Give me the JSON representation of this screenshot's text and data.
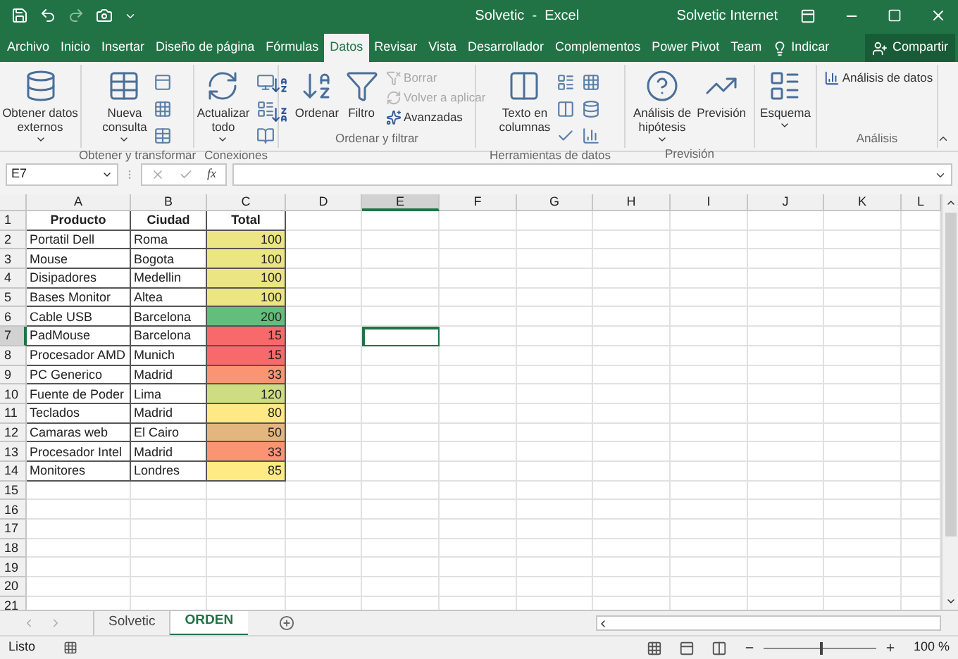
{
  "title_bar": {
    "title": "Solvetic  -  Excel",
    "user": "Solvetic Internet"
  },
  "menu_tabs": [
    {
      "label": "Archivo",
      "selected": false
    },
    {
      "label": "Inicio",
      "selected": false
    },
    {
      "label": "Insertar",
      "selected": false
    },
    {
      "label": "Diseño de página",
      "selected": false
    },
    {
      "label": "Fórmulas",
      "selected": false
    },
    {
      "label": "Datos",
      "selected": true
    },
    {
      "label": "Revisar",
      "selected": false
    },
    {
      "label": "Vista",
      "selected": false
    },
    {
      "label": "Desarrollador",
      "selected": false
    },
    {
      "label": "Complementos",
      "selected": false
    },
    {
      "label": "Power Pivot",
      "selected": false
    },
    {
      "label": "Team",
      "selected": false
    }
  ],
  "tell_me": "Indicar",
  "share": "Compartir",
  "ribbon_groups": [
    {
      "buttons": [
        {
          "kind": "large",
          "lines": [
            "Obtener datos",
            "externos"
          ],
          "dropdown": true
        }
      ]
    },
    {
      "label": "Obtener y transformar",
      "buttons": [
        {
          "kind": "large",
          "lines": [
            "Nueva",
            "consulta"
          ],
          "dropdown": true
        }
      ]
    },
    {
      "label": "Conexiones",
      "buttons": [
        {
          "kind": "large",
          "lines": [
            "Actualizar",
            "todo"
          ],
          "dropdown": true
        }
      ]
    },
    {
      "label": "Ordenar y filtrar",
      "buttons": [
        {
          "kind": "large",
          "lines": [
            "Ordenar"
          ],
          "dropdown": false
        },
        {
          "kind": "large",
          "lines": [
            "Filtro"
          ],
          "dropdown": false
        },
        {
          "kind": "small",
          "lines": [
            "Borrar"
          ],
          "disabled": true
        },
        {
          "kind": "small",
          "lines": [
            "Volver a aplicar"
          ],
          "disabled": true
        },
        {
          "kind": "small",
          "lines": [
            "Avanzadas"
          ],
          "disabled": false
        }
      ]
    },
    {
      "label": "Herramientas de datos",
      "buttons": [
        {
          "kind": "large",
          "lines": [
            "Texto en",
            "columnas"
          ],
          "dropdown": false
        }
      ]
    },
    {
      "label": "Previsión",
      "buttons": [
        {
          "kind": "large",
          "lines": [
            "Análisis de",
            "hipótesis"
          ],
          "dropdown": true
        },
        {
          "kind": "large",
          "lines": [
            "Previsión"
          ],
          "dropdown": false
        }
      ]
    },
    {
      "buttons": [
        {
          "kind": "large",
          "lines": [
            "Esquema"
          ],
          "dropdown": true
        }
      ]
    },
    {
      "label": "Análisis",
      "buttons": [
        {
          "kind": "small",
          "lines": [
            "Análisis de datos"
          ],
          "disabled": false
        }
      ]
    }
  ],
  "formula_bar": {
    "name_box": "E7",
    "function_label": "fx"
  },
  "sheet": {
    "columns": [
      {
        "label": "A",
        "selected": false
      },
      {
        "label": "B",
        "selected": false
      },
      {
        "label": "C",
        "selected": false
      },
      {
        "label": "D",
        "selected": false
      },
      {
        "label": "E",
        "selected": true
      },
      {
        "label": "F",
        "selected": false
      },
      {
        "label": "G",
        "selected": false
      },
      {
        "label": "H",
        "selected": false
      },
      {
        "label": "I",
        "selected": false
      },
      {
        "label": "J",
        "selected": false
      },
      {
        "label": "K",
        "selected": false
      },
      {
        "label": "L",
        "selected": false
      }
    ],
    "rows": [
      {
        "number": "1",
        "selected": false,
        "cells": [
          {
            "text": "Producto",
            "kind": "header"
          },
          {
            "text": "Ciudad",
            "kind": "header"
          },
          {
            "text": "Total",
            "kind": "header"
          }
        ]
      },
      {
        "number": "2",
        "selected": false,
        "cells": [
          {
            "text": "Portatil Dell",
            "kind": "text"
          },
          {
            "text": "Roma",
            "kind": "text"
          },
          {
            "text": "100",
            "kind": "number",
            "color": "#ece583"
          }
        ]
      },
      {
        "number": "3",
        "selected": false,
        "cells": [
          {
            "text": "Mouse",
            "kind": "text"
          },
          {
            "text": "Bogota",
            "kind": "text"
          },
          {
            "text": "100",
            "kind": "number",
            "color": "#ece583"
          }
        ]
      },
      {
        "number": "4",
        "selected": false,
        "cells": [
          {
            "text": "Disipadores",
            "kind": "text"
          },
          {
            "text": "Medellin",
            "kind": "text"
          },
          {
            "text": "100",
            "kind": "number",
            "color": "#ece583"
          }
        ]
      },
      {
        "number": "5",
        "selected": false,
        "cells": [
          {
            "text": "Bases Monitor",
            "kind": "text"
          },
          {
            "text": "Altea",
            "kind": "text"
          },
          {
            "text": "100",
            "kind": "number",
            "color": "#ece583"
          }
        ]
      },
      {
        "number": "6",
        "selected": false,
        "cells": [
          {
            "text": "Cable USB",
            "kind": "text"
          },
          {
            "text": "Barcelona",
            "kind": "text"
          },
          {
            "text": "200",
            "kind": "number",
            "color": "#63be7b"
          }
        ]
      },
      {
        "number": "7",
        "selected": true,
        "cells": [
          {
            "text": "PadMouse",
            "kind": "text"
          },
          {
            "text": "Barcelona",
            "kind": "text"
          },
          {
            "text": "15",
            "kind": "number",
            "color": "#f8696b"
          }
        ]
      },
      {
        "number": "8",
        "selected": false,
        "cells": [
          {
            "text": "Procesador AMD",
            "kind": "text"
          },
          {
            "text": "Munich",
            "kind": "text"
          },
          {
            "text": "15",
            "kind": "number",
            "color": "#f8696b"
          }
        ]
      },
      {
        "number": "9",
        "selected": false,
        "cells": [
          {
            "text": "PC Generico",
            "kind": "text"
          },
          {
            "text": "Madrid",
            "kind": "text"
          },
          {
            "text": "33",
            "kind": "number",
            "color": "#fa9473"
          }
        ]
      },
      {
        "number": "10",
        "selected": false,
        "cells": [
          {
            "text": "Fuente de Poder",
            "kind": "text"
          },
          {
            "text": "Lima",
            "kind": "text"
          },
          {
            "text": "120",
            "kind": "number",
            "color": "#cfdd82"
          }
        ]
      },
      {
        "number": "11",
        "selected": false,
        "cells": [
          {
            "text": "Teclados",
            "kind": "text"
          },
          {
            "text": "Madrid",
            "kind": "text"
          },
          {
            "text": "80",
            "kind": "number",
            "color": "#ffe984"
          }
        ]
      },
      {
        "number": "12",
        "selected": false,
        "cells": [
          {
            "text": "Camaras web",
            "kind": "text"
          },
          {
            "text": "El Cairo",
            "kind": "text"
          },
          {
            "text": "50",
            "kind": "number",
            "color": "#e3b57f"
          }
        ]
      },
      {
        "number": "13",
        "selected": false,
        "cells": [
          {
            "text": "Procesador Intel",
            "kind": "text"
          },
          {
            "text": "Madrid",
            "kind": "text"
          },
          {
            "text": "33",
            "kind": "number",
            "color": "#fa9473"
          }
        ]
      },
      {
        "number": "14",
        "selected": false,
        "cells": [
          {
            "text": "Monitores",
            "kind": "text"
          },
          {
            "text": "Londres",
            "kind": "text"
          },
          {
            "text": "85",
            "kind": "number",
            "color": "#ffea84"
          }
        ]
      },
      {
        "number": "15",
        "selected": false,
        "cells": []
      },
      {
        "number": "16",
        "selected": false,
        "cells": []
      },
      {
        "number": "17",
        "selected": false,
        "cells": []
      },
      {
        "number": "18",
        "selected": false,
        "cells": []
      },
      {
        "number": "19",
        "selected": false,
        "cells": []
      },
      {
        "number": "20",
        "selected": false,
        "cells": []
      },
      {
        "number": "21",
        "selected": false,
        "cells": []
      }
    ]
  },
  "sheet_tabs": [
    {
      "label": "Solvetic",
      "selected": false
    },
    {
      "label": "ORDEN",
      "selected": true
    }
  ],
  "status_bar": {
    "status": "Listo",
    "zoom_slider": {
      "level": 0.5
    },
    "zoom": "100 %"
  }
}
